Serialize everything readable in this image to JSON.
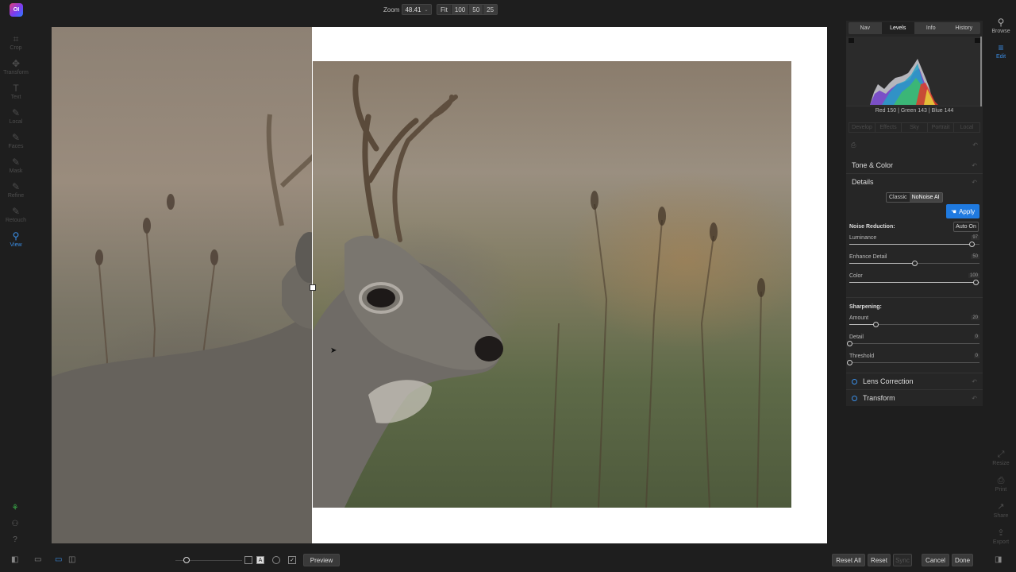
{
  "app": {
    "logo_text": "OI"
  },
  "zoom": {
    "label": "Zoom",
    "value": "48.41",
    "presets": [
      "Fit",
      "100",
      "50",
      "25"
    ]
  },
  "left_tools": [
    {
      "name": "crop",
      "label": "Crop",
      "icon": "⌗"
    },
    {
      "name": "transform",
      "label": "Transform",
      "icon": "✥"
    },
    {
      "name": "text",
      "label": "Text",
      "icon": "T"
    },
    {
      "name": "local",
      "label": "Local",
      "icon": "✎"
    },
    {
      "name": "faces",
      "label": "Faces",
      "icon": "✎"
    },
    {
      "name": "mask",
      "label": "Mask",
      "icon": "✎"
    },
    {
      "name": "refine",
      "label": "Refine",
      "icon": "✎"
    },
    {
      "name": "retouch",
      "label": "Retouch",
      "icon": "✎"
    },
    {
      "name": "view",
      "label": "View",
      "icon": "⚲"
    }
  ],
  "right_tabs": [
    "Nav",
    "Levels",
    "Info",
    "History"
  ],
  "rgb_readout": "Red 150 | Green 143 | Blue 144",
  "module_tabs": [
    "Develop",
    "Effects",
    "Sky",
    "Portrait",
    "Local"
  ],
  "sections": {
    "tone_color": "Tone & Color",
    "details": "Details",
    "lens_correction": "Lens Correction",
    "transform": "Transform"
  },
  "noise_mode": {
    "options": [
      "Classic",
      "NoNoise AI"
    ],
    "selected": "NoNoise AI"
  },
  "apply_label": "Apply",
  "noise_reduction": {
    "title": "Noise Reduction:",
    "auto_label": "Auto On",
    "sliders": [
      {
        "label": "Luminance",
        "value": "97",
        "percent": 0.94
      },
      {
        "label": "Enhance Detail",
        "value": "50",
        "percent": 0.5
      },
      {
        "label": "Color",
        "value": "100",
        "percent": 0.97
      }
    ]
  },
  "sharpening": {
    "title": "Sharpening:",
    "sliders": [
      {
        "label": "Amount",
        "value": "20",
        "percent": 0.2
      },
      {
        "label": "Detail",
        "value": "0",
        "percent": 0.0
      },
      {
        "label": "Threshold",
        "value": "0",
        "percent": 0.0
      }
    ]
  },
  "far_right": [
    {
      "label": "Browse",
      "icon": "⚲"
    },
    {
      "label": "Edit",
      "icon": "≡"
    }
  ],
  "far_right_bottom": [
    {
      "label": "Resize",
      "icon": "⤢"
    },
    {
      "label": "Print",
      "icon": "⎙"
    },
    {
      "label": "Share",
      "icon": "↗"
    },
    {
      "label": "Export",
      "icon": "⇪"
    }
  ],
  "bottom": {
    "preview": "Preview",
    "reset_all": "Reset All",
    "reset": "Reset",
    "sync": "Sync",
    "cancel": "Cancel",
    "done": "Done"
  },
  "colors": {
    "accent": "#1f7ae0",
    "active_icon": "#3a8ee6",
    "background": "#1e1e1e",
    "panel": "#262626"
  }
}
